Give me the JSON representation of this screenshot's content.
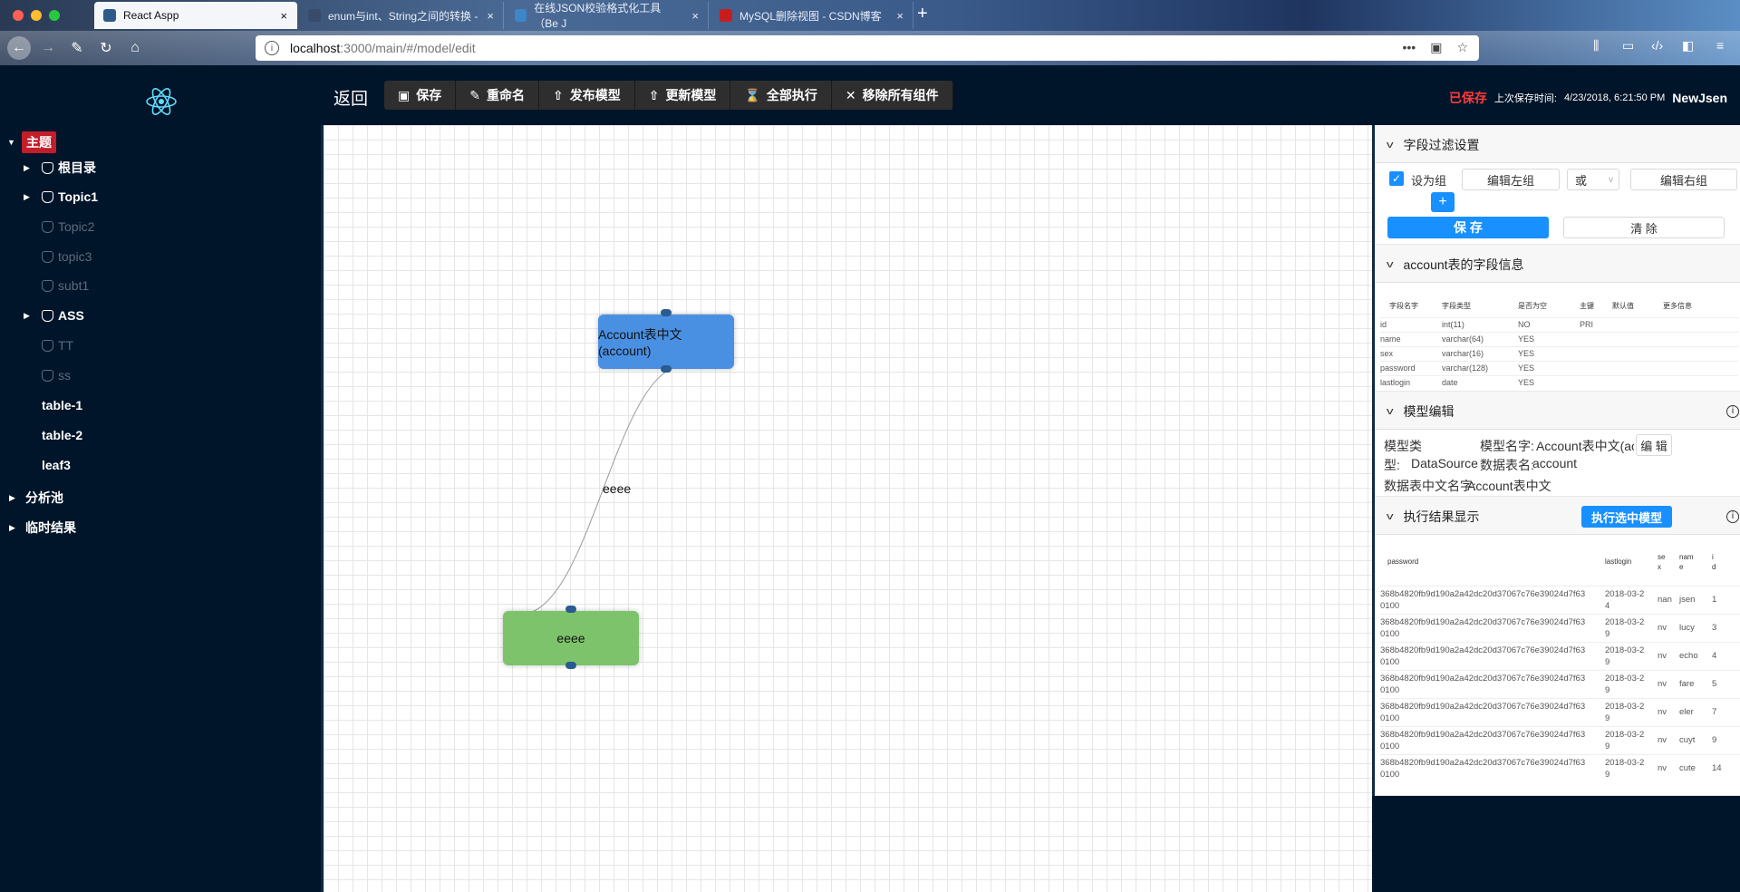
{
  "browser": {
    "tabs": [
      {
        "label": "React Aspp",
        "active": true,
        "color": "#2d5a8a"
      },
      {
        "label": "enum与int、String之间的转换 -",
        "active": false,
        "color": "#3a4a6a"
      },
      {
        "label": "在线JSON校验格式化工具（Be J",
        "active": false,
        "color": "#3b87c7"
      },
      {
        "label": "MySQL删除视图 - CSDN博客",
        "active": false,
        "color": "#c91d1d"
      }
    ],
    "url_host": "localhost",
    "url_rest": ":3000/main/#/model/edit",
    "info_glyph": "i",
    "close_glyph": "×",
    "new_tab_glyph": "+"
  },
  "sidebar": {
    "items": [
      {
        "label": "主题",
        "highlight": true
      },
      {
        "label": "根目录"
      },
      {
        "label": "Topic1"
      },
      {
        "label": "Topic2"
      },
      {
        "label": "topic3"
      },
      {
        "label": "subt1"
      },
      {
        "label": "ASS"
      },
      {
        "label": "TT"
      },
      {
        "label": "ss"
      },
      {
        "label": "table-1"
      },
      {
        "label": "table-2"
      },
      {
        "label": "leaf3"
      },
      {
        "label": "分析池"
      },
      {
        "label": "临时结果"
      }
    ]
  },
  "toolbar": {
    "back": "返回",
    "save": "保存",
    "rename": "重命名",
    "publish": "发布模型",
    "update": "更新模型",
    "run_all": "全部执行",
    "remove_all": "移除所有组件",
    "saved_status": "已保存",
    "last_saved_label": "上次保存时间:",
    "last_saved_time": "4/23/2018, 6:21:50 PM",
    "user": "NewJsen"
  },
  "canvas": {
    "node_account": "Account表中文(account)",
    "node_eeee": "eeee",
    "edge_label": "eeee",
    "accent_blue": "#4a90e2",
    "accent_green": "#7dc36b"
  },
  "panel": {
    "filter": {
      "title": "字段过滤设置",
      "group_label": "设为组",
      "edit_left": "编辑左组",
      "op": "或",
      "edit_right": "编辑右组",
      "add": "+",
      "save": "保 存",
      "clear": "清 除"
    },
    "fields": {
      "title": "account表的字段信息",
      "headers": [
        "字段名字",
        "字段类型",
        "是否为空",
        "主键",
        "默认值",
        "更多信息"
      ],
      "rows": [
        [
          "id",
          "int(11)",
          "NO",
          "PRI",
          "",
          ""
        ],
        [
          "name",
          "varchar(64)",
          "YES",
          "",
          "",
          ""
        ],
        [
          "sex",
          "varchar(16)",
          "YES",
          "",
          "",
          ""
        ],
        [
          "password",
          "varchar(128)",
          "YES",
          "",
          "",
          ""
        ],
        [
          "lastlogin",
          "date",
          "YES",
          "",
          "",
          ""
        ]
      ]
    },
    "model": {
      "title": "模型编辑",
      "type_label": "模型类",
      "type_label2": "型:",
      "type_value": "DataSource",
      "name_label": "模型名字:",
      "name_value": "Account表中文(acco",
      "edit_btn": "编 辑",
      "table_label": "数据表名:",
      "table_value": "account",
      "cn_label": "数据表中文名字:",
      "cn_value": "Account表中文"
    },
    "results": {
      "title": "执行结果显示",
      "run_btn": "执行选中模型",
      "headers": [
        "password",
        "lastlogin",
        "se\nx",
        "nam\ne",
        "i\nd"
      ],
      "rows": [
        [
          "368b4820fb9d190a2a42dc20d37067c76e39024d7f63\n0100",
          "2018-03-2\n4",
          "nan",
          "jsen",
          "1"
        ],
        [
          "368b4820fb9d190a2a42dc20d37067c76e39024d7f63\n0100",
          "2018-03-2\n9",
          "nv",
          "lucy",
          "3"
        ],
        [
          "368b4820fb9d190a2a42dc20d37067c76e39024d7f63\n0100",
          "2018-03-2\n9",
          "nv",
          "echo",
          "4"
        ],
        [
          "368b4820fb9d190a2a42dc20d37067c76e39024d7f63\n0100",
          "2018-03-2\n9",
          "nv",
          "fare",
          "5"
        ],
        [
          "368b4820fb9d190a2a42dc20d37067c76e39024d7f63\n0100",
          "2018-03-2\n9",
          "nv",
          "eler",
          "7"
        ],
        [
          "368b4820fb9d190a2a42dc20d37067c76e39024d7f63\n0100",
          "2018-03-2\n9",
          "nv",
          "cuyt",
          "9"
        ],
        [
          "368b4820fb9d190a2a42dc20d37067c76e39024d7f63\n0100",
          "2018-03-2\n9",
          "nv",
          "cute",
          "14"
        ]
      ]
    }
  }
}
